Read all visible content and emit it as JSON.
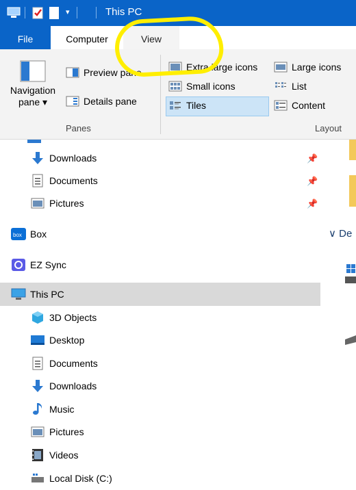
{
  "window": {
    "title": "This PC"
  },
  "tabs": {
    "file": "File",
    "computer": "Computer",
    "view": "View"
  },
  "ribbon": {
    "navigation_pane": "Navigation",
    "navigation_pane2": "pane ▾",
    "preview_pane": "Preview pane",
    "details_pane": "Details pane",
    "panes_group": "Panes",
    "extra_large_icons": "Extra large icons",
    "large_icons": "Large icons",
    "small_icons": "Small icons",
    "list": "List",
    "tiles": "Tiles",
    "content": "Content",
    "layout_group": "Layout"
  },
  "nav": {
    "quick_access": [
      {
        "label": "Downloads"
      },
      {
        "label": "Documents"
      },
      {
        "label": "Pictures"
      }
    ],
    "box": "Box",
    "ez_sync": "EZ Sync",
    "this_pc": "This PC",
    "this_pc_items": [
      {
        "label": "3D Objects"
      },
      {
        "label": "Desktop"
      },
      {
        "label": "Documents"
      },
      {
        "label": "Downloads"
      },
      {
        "label": "Music"
      },
      {
        "label": "Pictures"
      },
      {
        "label": "Videos"
      },
      {
        "label": "Local Disk (C:)"
      }
    ]
  },
  "content": {
    "devices_header": "De"
  },
  "colors": {
    "titlebar": "#0a64c8",
    "selection": "#cce4f7",
    "annotation": "#ffee00"
  }
}
